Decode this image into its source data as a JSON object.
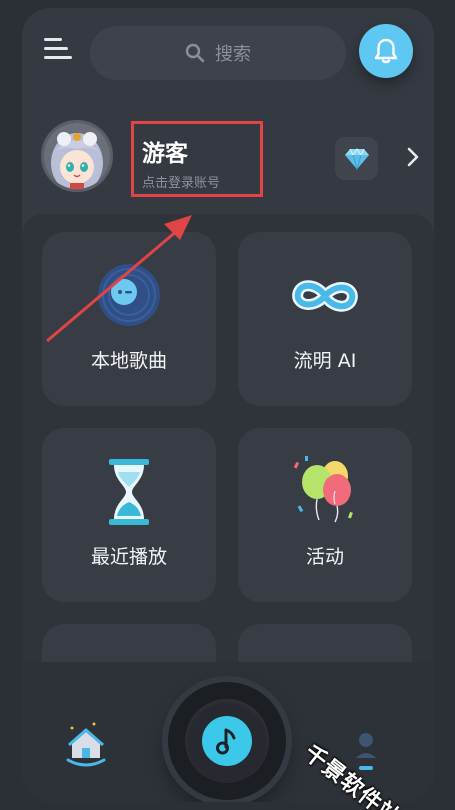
{
  "search": {
    "placeholder": "搜索"
  },
  "profile": {
    "username": "游客",
    "login_hint": "点击登录账号"
  },
  "features": [
    {
      "label": "本地歌曲",
      "icon": "vinyl-disc-icon"
    },
    {
      "label": "流明 AI",
      "icon": "infinity-icon"
    },
    {
      "label": "最近播放",
      "icon": "hourglass-icon"
    },
    {
      "label": "活动",
      "icon": "balloons-icon"
    }
  ],
  "bottom_nav": {
    "home_icon": "home-icon",
    "play_icon": "music-note-icon",
    "mine_icon": "mine-icon"
  },
  "watermark": "千景软件站",
  "colors": {
    "accent": "#5ec7f2",
    "play": "#3cc8e8",
    "highlight_box": "#e04444",
    "background": "#353a42"
  }
}
